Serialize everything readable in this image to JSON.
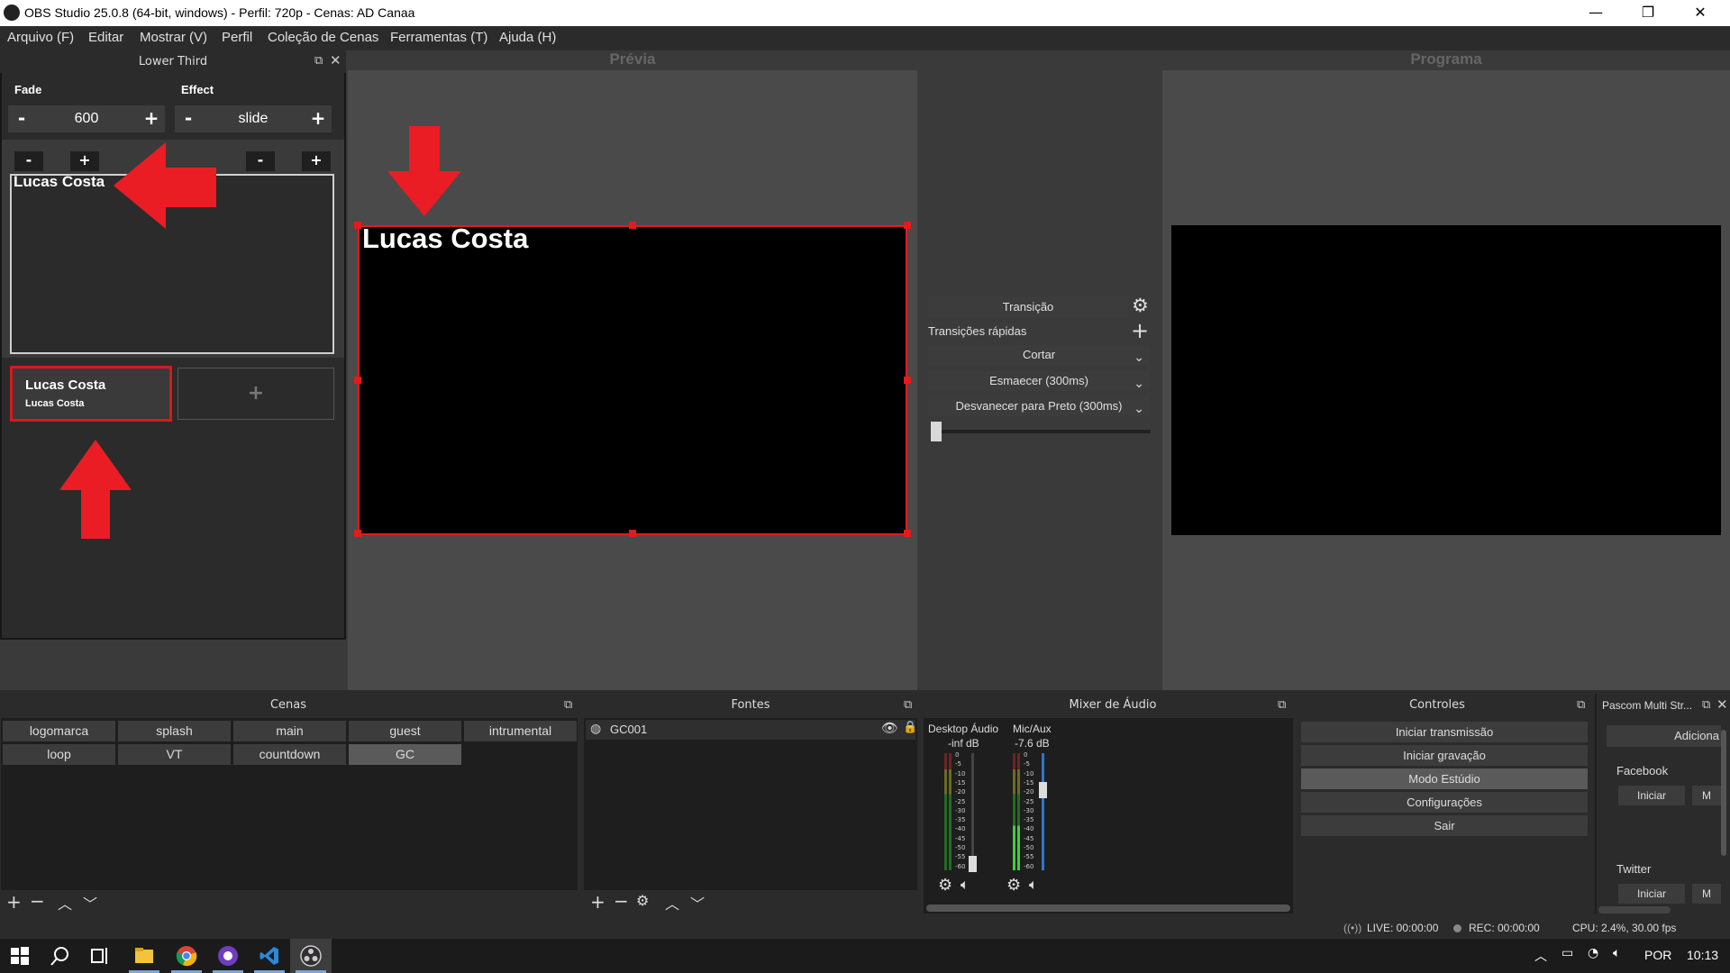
{
  "window": {
    "title": "OBS Studio 25.0.8 (64-bit, windows) - Perfil: 720p - Cenas: AD Canaa",
    "minimize": "—",
    "maximize": "❐",
    "close": "✕"
  },
  "menu": [
    "Arquivo (F)",
    "Editar",
    "Mostrar (V)",
    "Perfil",
    "Coleção de Cenas",
    "Ferramentas (T)",
    "Ajuda (H)"
  ],
  "lower_third": {
    "dock_title": "Lower Third",
    "fade_label": "Fade",
    "effect_label": "Effect",
    "fade_value": "600",
    "effect_value": "slide",
    "minus": "-",
    "plus": "+",
    "editor_name": "Lucas Costa",
    "card_title": "Lucas Costa",
    "card_subtitle": "Lucas Costa",
    "add_card": "+"
  },
  "preview": {
    "title": "Prévia",
    "canvas_text": "Lucas Costa"
  },
  "program": {
    "title": "Programa"
  },
  "transition": {
    "button": "Transição",
    "quick_label": "Transições rápidas",
    "items": [
      "Cortar",
      "Esmaecer (300ms)",
      "Desvanecer para Preto (300ms)"
    ]
  },
  "scenes": {
    "title": "Cenas",
    "items": [
      "logomarca",
      "splash",
      "main",
      "guest",
      "intrumental",
      "loop",
      "VT",
      "countdown",
      "GC"
    ],
    "active": "GC"
  },
  "sources": {
    "title": "Fontes",
    "items": [
      "GC001"
    ]
  },
  "mixer": {
    "title": "Mixer de Áudio",
    "channels": [
      {
        "name": "Desktop Áudio",
        "level": "-inf dB"
      },
      {
        "name": "Mic/Aux",
        "level": "-7.6 dB"
      }
    ],
    "scale": [
      "0",
      "-5",
      "-10",
      "-15",
      "-20",
      "-25",
      "-30",
      "-35",
      "-40",
      "-45",
      "-50",
      "-55",
      "-60"
    ]
  },
  "controls": {
    "title": "Controles",
    "buttons": [
      "Iniciar transmissão",
      "Iniciar gravação",
      "Modo Estúdio",
      "Configurações",
      "Sair"
    ],
    "active": "Modo Estúdio"
  },
  "multistream": {
    "title": "Pascom Multi Str...",
    "add": "Adiciona",
    "targets": [
      {
        "name": "Facebook",
        "start": "Iniciar",
        "more": "M"
      },
      {
        "name": "Twitter",
        "start": "Iniciar",
        "more": "M"
      }
    ]
  },
  "status": {
    "live": "LIVE: 00:00:00",
    "rec": "REC: 00:00:00",
    "cpu": "CPU: 2.4%, 30.00 fps"
  },
  "taskbar": {
    "language": "POR",
    "time": "10:13"
  },
  "colors": {
    "accent_red": "#e31b1b",
    "panel": "#2b2b2b",
    "button": "#3c3c3c"
  }
}
